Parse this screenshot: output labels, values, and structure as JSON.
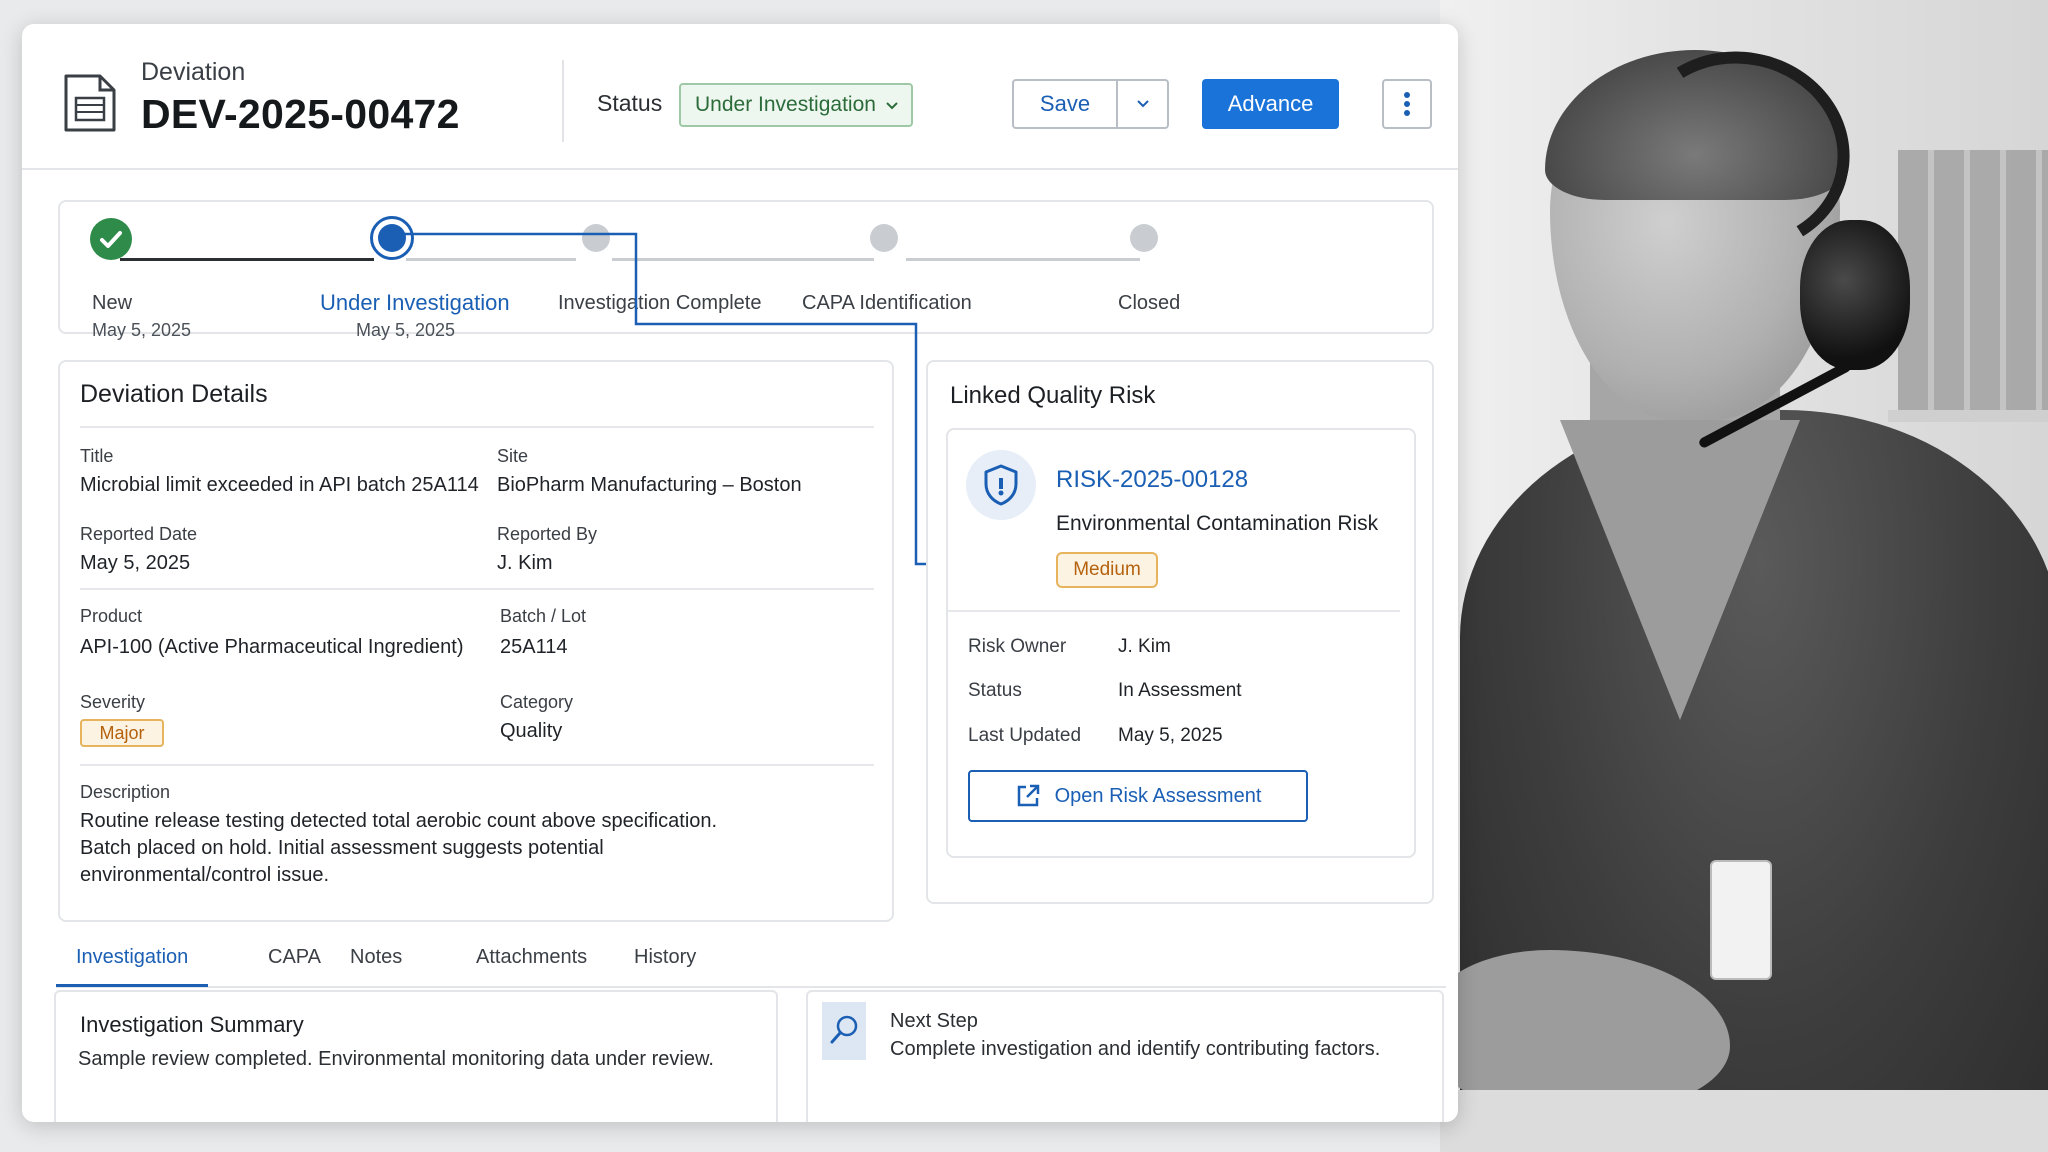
{
  "header": {
    "entity_type": "Deviation",
    "record_id": "DEV-2025-00472",
    "status_label": "Status",
    "status_value": "Under Investigation",
    "save_label": "Save",
    "advance_label": "Advance"
  },
  "stepper": {
    "steps": [
      {
        "label": "New",
        "date": "May 5, 2025",
        "state": "done"
      },
      {
        "label": "Under Investigation",
        "date": "May 5, 2025",
        "state": "current"
      },
      {
        "label": "Investigation Complete",
        "date": "",
        "state": "pending"
      },
      {
        "label": "CAPA Identification",
        "date": "",
        "state": "pending"
      },
      {
        "label": "Closed",
        "date": "",
        "state": "pending"
      }
    ]
  },
  "details": {
    "title": "Deviation Details",
    "fields": {
      "title": {
        "label": "Title",
        "value": "Microbial limit exceeded in API batch 25A114"
      },
      "site": {
        "label": "Site",
        "value": "BioPharm Manufacturing – Boston"
      },
      "reported_date": {
        "label": "Reported Date",
        "value": "May 5, 2025"
      },
      "reported_by": {
        "label": "Reported By",
        "value": "J. Kim"
      },
      "product": {
        "label": "Product",
        "value": "API-100 (Active Pharmaceutical Ingredient)"
      },
      "batch": {
        "label": "Batch / Lot",
        "value": "25A114"
      },
      "severity": {
        "label": "Severity",
        "value": "Major"
      },
      "category": {
        "label": "Category",
        "value": "Quality"
      },
      "description": {
        "label": "Description",
        "lines": [
          "Routine release testing detected total aerobic count above specification.",
          "Batch placed on hold. Initial assessment suggests potential",
          "environmental/control issue."
        ]
      }
    }
  },
  "risk": {
    "title": "Linked Quality Risk",
    "id": "RISK-2025-00128",
    "name": "Environmental Contamination Risk",
    "level": "Medium",
    "owner_label": "Risk Owner",
    "owner": "J. Kim",
    "status_label": "Status",
    "status": "In Assessment",
    "updated_label": "Last Updated",
    "updated": "May 5, 2025",
    "open_label": "Open Risk Assessment"
  },
  "tabs": [
    "Investigation",
    "CAPA",
    "Notes",
    "Attachments",
    "History"
  ],
  "active_tab": "Investigation",
  "investigation": {
    "title": "Investigation Summary",
    "text": "Sample review completed. Environmental monitoring data under review."
  },
  "next_step": {
    "label": "Next Step",
    "text": "Complete investigation and identify contributing factors."
  },
  "colors": {
    "accent": "#1a73d9",
    "link": "#1a5fb4",
    "success": "#2e8b4a",
    "warning": "#e7b35c"
  },
  "icons": {
    "document": "document-icon",
    "chevron": "chevron-down-icon",
    "more": "more-vertical-icon",
    "check": "check-icon",
    "shield": "shield-icon",
    "external": "external-link-icon",
    "search": "search-icon"
  }
}
